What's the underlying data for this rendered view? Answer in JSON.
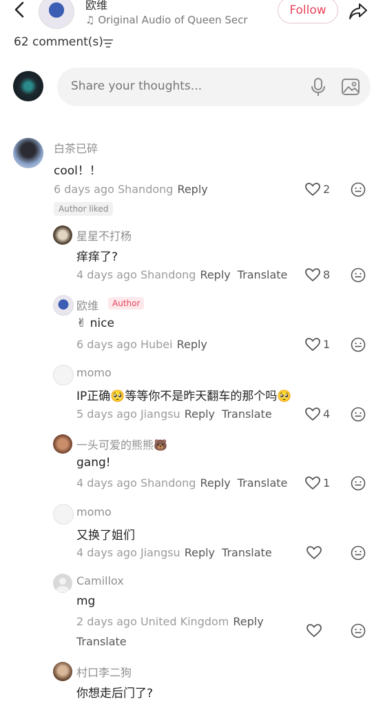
{
  "header": {
    "name": "欧维",
    "audio": "♫ Original Audio of Queen Secr",
    "follow_label": "Follow"
  },
  "comments_header": {
    "count_label": "62 comment(s)"
  },
  "input": {
    "placeholder": "Share your thoughts..."
  },
  "comments": [
    {
      "user": "白茶已碎",
      "text": "cool！！",
      "meta": "6 days ago Shandong",
      "reply": "Reply",
      "likes": "2",
      "badge": "Author liked"
    },
    {
      "user": "星星不打杨",
      "text": "痒痒了?",
      "meta": "4 days ago Shandong",
      "reply": "Reply",
      "translate": "Translate",
      "likes": "8"
    },
    {
      "user": "欧维",
      "tag": "Author",
      "text": "✌ nice",
      "meta": "6 days ago Hubei",
      "reply": "Reply",
      "likes": "1"
    },
    {
      "user": "momo",
      "text": "IP正确🥺等等你不是昨天翻车的那个吗🥺",
      "meta": "5 days ago Jiangsu",
      "reply": "Reply",
      "translate": "Translate",
      "likes": "4"
    },
    {
      "user": "一头可爱的熊熊🐻",
      "text": "gang!",
      "meta": "4 days ago Shandong",
      "reply": "Reply",
      "translate": "Translate",
      "likes": "1"
    },
    {
      "user": "momo",
      "text": "又换了姐们",
      "meta": "4 days ago Jiangsu",
      "reply": "Reply",
      "translate": "Translate"
    },
    {
      "user": "Camillox",
      "text": "mg",
      "meta": "2 days ago United Kingdom",
      "reply": "Reply",
      "translate": "Translate"
    },
    {
      "user": "村口李二狗",
      "text": "你想走后门了?"
    }
  ],
  "colors": {
    "accent": "#e8435c",
    "meta": "#9b9b9b"
  }
}
